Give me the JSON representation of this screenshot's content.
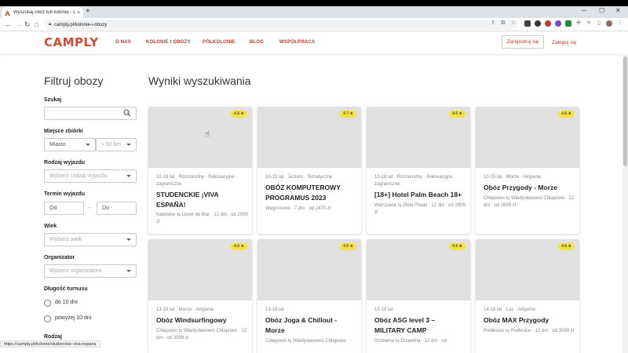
{
  "browser": {
    "tab_title": "Wyszukaj obóz lub kolonię - Ca…",
    "tab_close": "×",
    "new_tab": "+",
    "url": "camply.pl/kolonie-i-obozy",
    "status_url": "https://camply.pl/kolonie/studenckie-viva-espana"
  },
  "site": {
    "logo": "CAMPLY",
    "nav": [
      "O NAS",
      "KOLONIE I OBOZY",
      "PÓŁKOLONIE",
      "BLOG",
      "WSPÓŁPRACA"
    ],
    "register": "Zarejestruj się",
    "login": "Zaloguj się"
  },
  "filters": {
    "title": "Filtruj obozy",
    "search_label": "Szukaj",
    "location_label": "Miejsce zbiórki",
    "city": "Miasto",
    "radius": "+ 50 km",
    "trip_type_label": "Rodzaj wyjazdu",
    "trip_type_placeholder": "Wybierz rodzaj wyjazdu",
    "date_label": "Termin wyjazdu",
    "date_from": "Od",
    "date_sep": "-",
    "date_to": "Do",
    "age_label": "Wiek",
    "age_placeholder": "Wybierz wiek",
    "organizer_label": "Organizator",
    "organizer_placeholder": "Wybierz organizatora",
    "duration_label": "Długość turnusu",
    "duration_options": [
      "do 10 dni",
      "powyżej 10 dni"
    ],
    "kind_label": "Rodzaj"
  },
  "results": {
    "title": "Wyniki wyszukiwania",
    "cards": [
      {
        "rating": "4.6 ★",
        "meta": "10-18 lat · Różnorodny · Rekreacyjne · zagraniczne",
        "title": "STUDENCKIE ¡VIVA ESPAÑA!",
        "route": "Katowice ⇆ Lloret de Mar · 12 dni · od 2009 zł"
      },
      {
        "rating": "4.7 ★",
        "meta": "10-15 lat · Jezioro · Tematyczne",
        "title": "OBÓZ KOMPUTEROWY PROGRAMUS 2023",
        "route": "Węgorzewo · 7 dni · od 2475 zł"
      },
      {
        "rating": "4.6 ★",
        "meta": "10-18 lat · Różnorodny · Rekreacyjne · zagraniczne",
        "title": "[18+] Hotel Palm Beach 18+",
        "route": "Warszawa ⇆ Złote Piaski · 12 dni · od 2809 zł"
      },
      {
        "rating": "4.6 ★",
        "meta": "10-15 lat · Morze · Aktywne",
        "title": "Obóz Przygody - Morze",
        "route": "Chłapowo ⇆ Władysławowo Chłapowo · 12 dni · od 2699 zł"
      },
      {
        "rating": "4.6 ★",
        "meta": "13-18 lat · Morze · Aktywne",
        "title": "Obóz Windsurfingowy",
        "route": "Chłapowo ⇆ Władysławowo Chłapowo · 12 dni · od 3399 zł"
      },
      {
        "rating": "4.6 ★",
        "meta": "13-18 lat",
        "title": "Obóz Joga & Chillout - Morze",
        "route": "Chłapowo ⇆ Władysławowo Chłapowo"
      },
      {
        "rating": "4.6 ★",
        "meta": "15-18 lat",
        "title": "Obóz ASG level 3 – MILITARY CAMP",
        "route": "Drzewina ⇆ Drzewina · 12 dni · od"
      },
      {
        "rating": "4.6 ★",
        "meta": "14-18 lat · Las · Aktywne",
        "title": "Obóz MAX Przygody",
        "route": "Podlesice ⇆ Podlesice · 12 dni · od 3099 zł"
      }
    ]
  },
  "colors": {
    "brand": "#d14b35",
    "rating_badge": "#f5e23b"
  }
}
